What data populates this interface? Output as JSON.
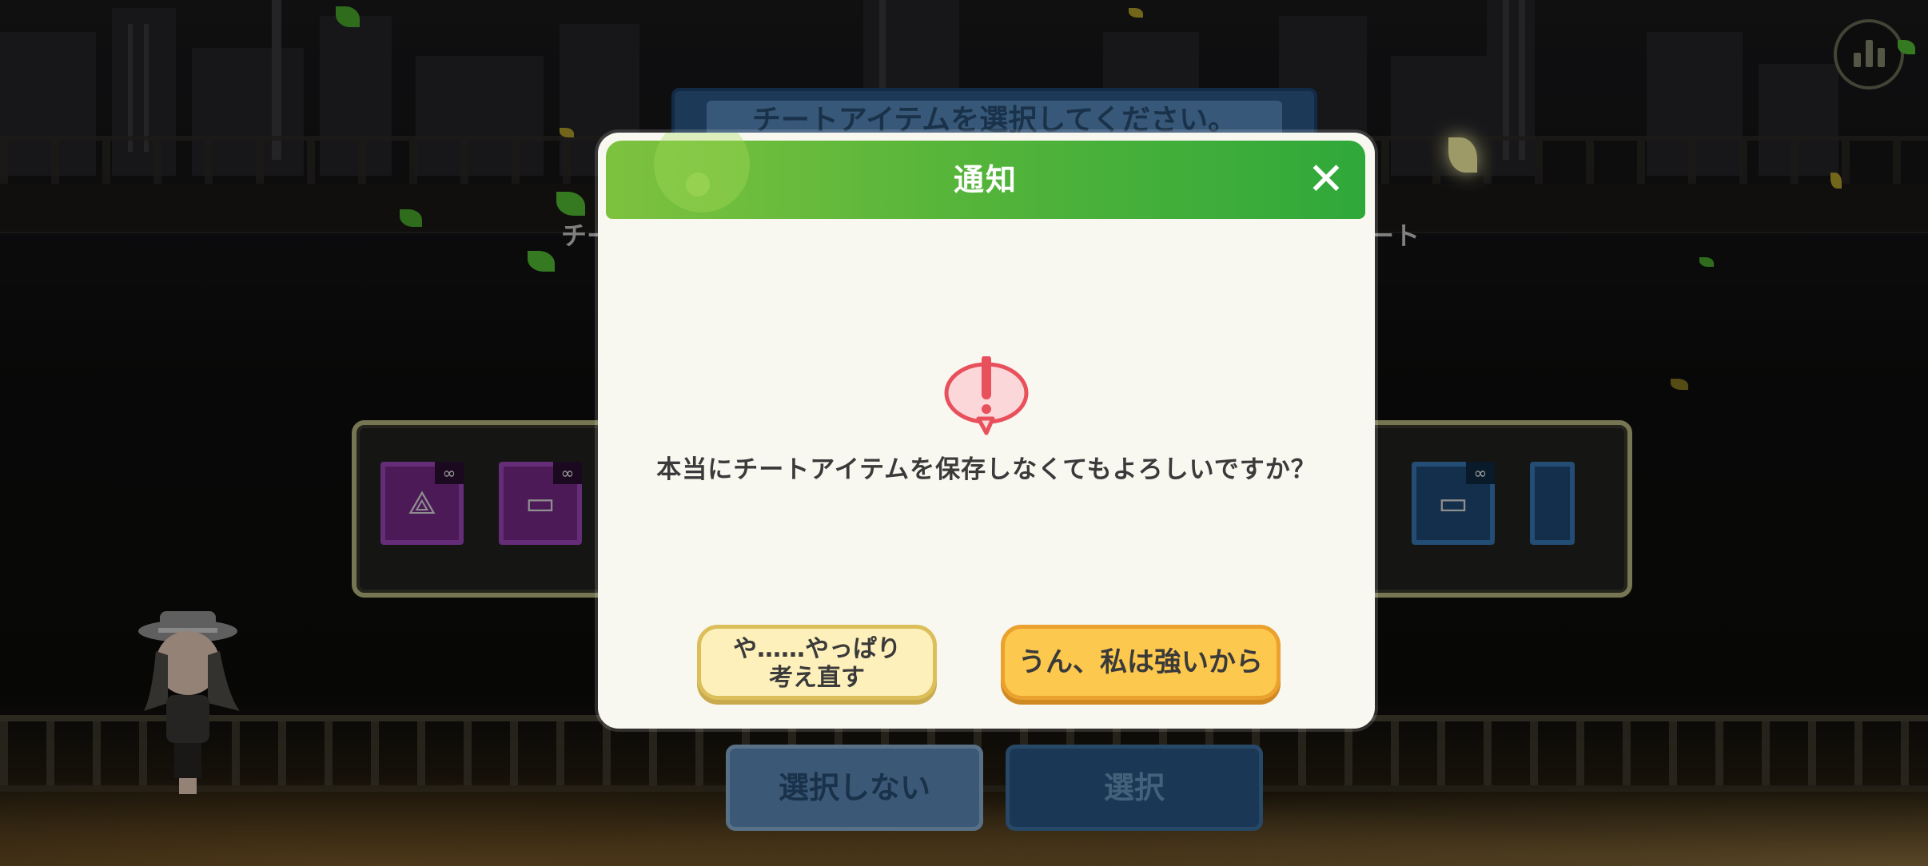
{
  "background": {
    "banner_text": "チートアイテムを選択してください。",
    "left_label": "チー",
    "right_label": "ート",
    "buttons": {
      "no_select": "選択しない",
      "select": "選択"
    },
    "infinity_badge": "∞"
  },
  "modal": {
    "title": "通知",
    "close_icon": "✕",
    "message": "本当にチートアイテムを保存しなくてもよろしいですか？",
    "reconsider_line1": "や……やっぱり",
    "reconsider_line2": "考え直す",
    "confirm_label": "うん、私は強いから"
  },
  "colors": {
    "header_green": "#2fa83a",
    "confirm_yellow": "#fcc84e",
    "reconsider_cream": "#fdf0bb",
    "alert_red": "#e8505b"
  }
}
